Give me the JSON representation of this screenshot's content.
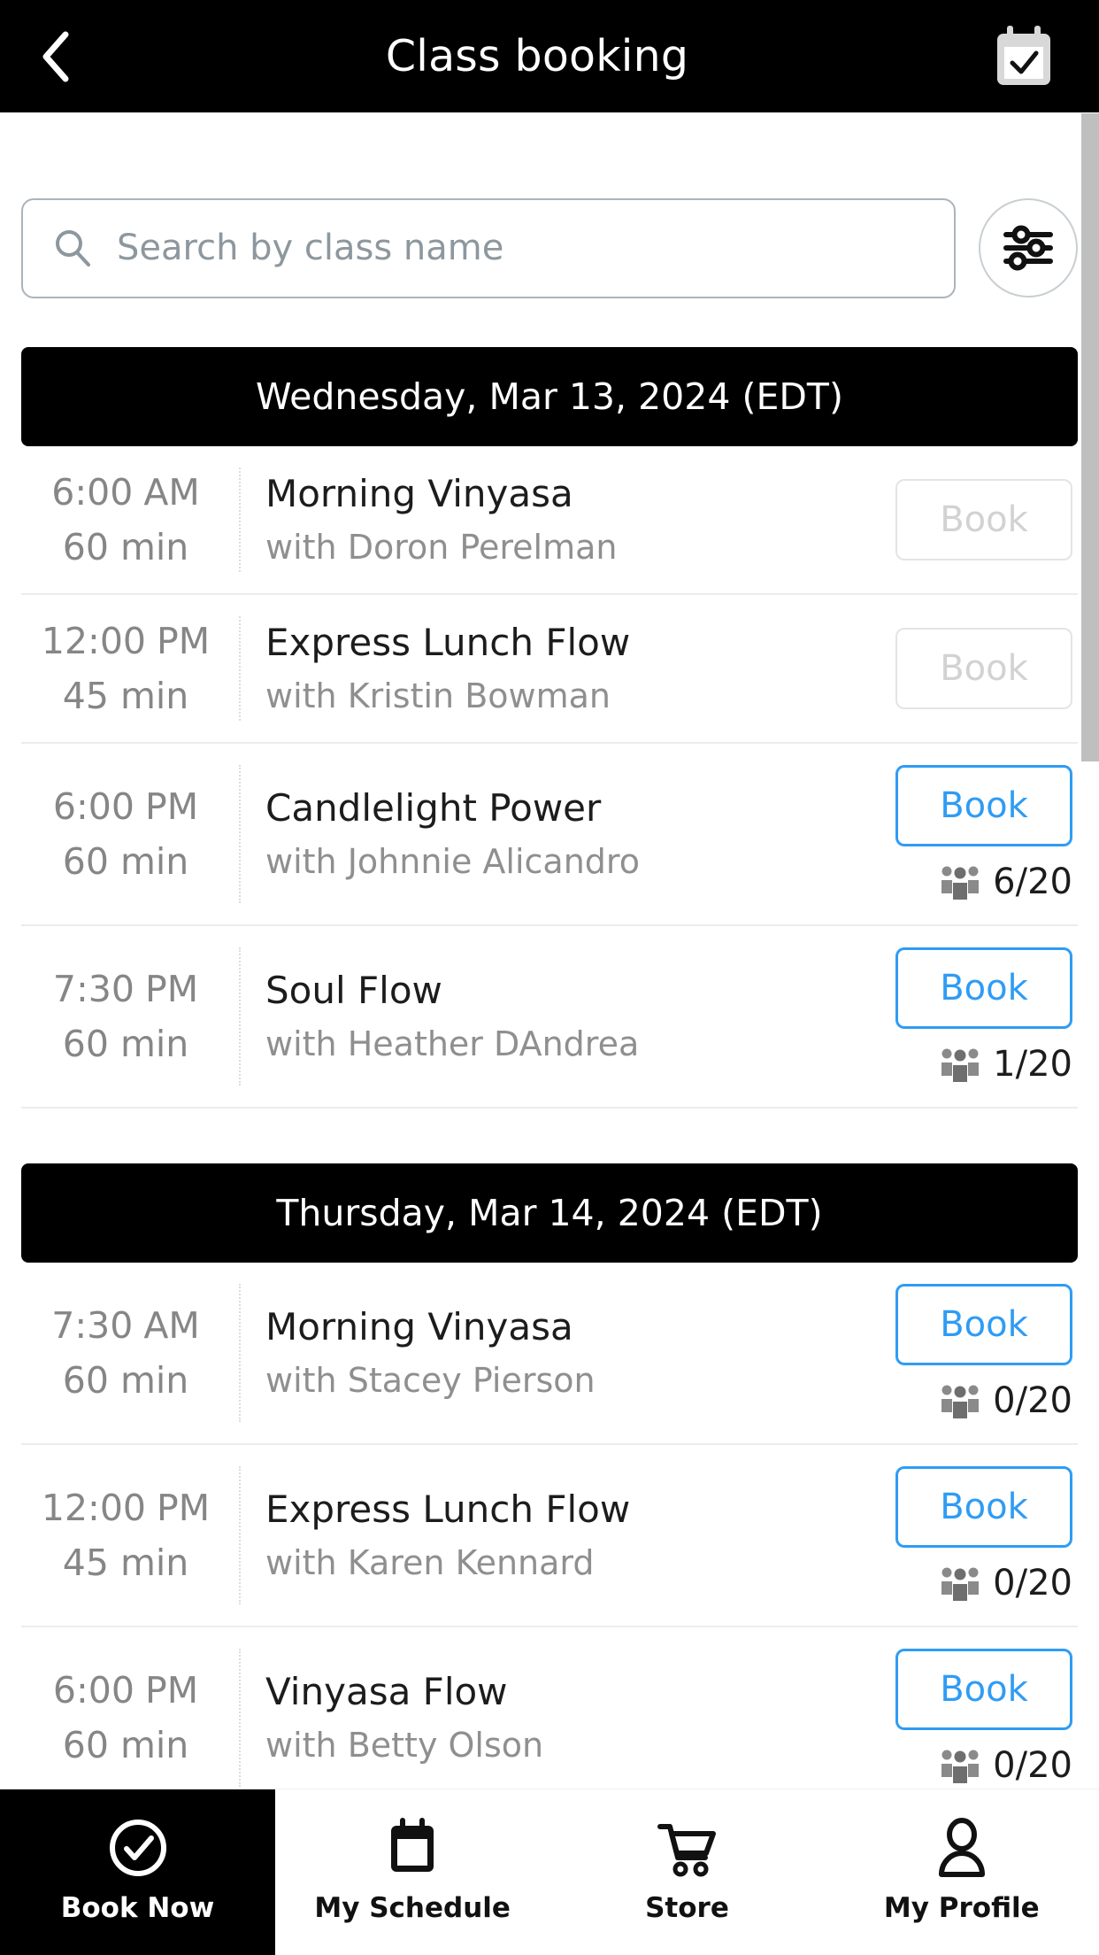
{
  "header": {
    "title": "Class booking",
    "back_icon": "chevron-left-icon",
    "calendar_icon": "calendar-check-icon"
  },
  "search": {
    "placeholder": "Search by class name",
    "value": "",
    "search_icon": "search-icon",
    "filter_icon": "sliders-filter-icon"
  },
  "days": [
    {
      "date_label": "Wednesday, Mar 13, 2024 (EDT)",
      "classes": [
        {
          "time": "6:00",
          "ampm": "AM",
          "duration": "60 min",
          "name": "Morning Vinyasa",
          "instructor": "with Doron Perelman",
          "book_label": "Book",
          "enabled": false,
          "capacity": ""
        },
        {
          "time": "12:00",
          "ampm": "PM",
          "duration": "45 min",
          "name": "Express Lunch Flow",
          "instructor": "with Kristin Bowman",
          "book_label": "Book",
          "enabled": false,
          "capacity": ""
        },
        {
          "time": "6:00",
          "ampm": "PM",
          "duration": "60 min",
          "name": "Candlelight Power",
          "instructor": "with Johnnie Alicandro",
          "book_label": "Book",
          "enabled": true,
          "capacity": "6/20"
        },
        {
          "time": "7:30",
          "ampm": "PM",
          "duration": "60 min",
          "name": "Soul Flow",
          "instructor": "with Heather DAndrea",
          "book_label": "Book",
          "enabled": true,
          "capacity": "1/20"
        }
      ]
    },
    {
      "date_label": "Thursday, Mar 14, 2024 (EDT)",
      "classes": [
        {
          "time": "7:30",
          "ampm": "AM",
          "duration": "60 min",
          "name": "Morning Vinyasa",
          "instructor": "with Stacey Pierson",
          "book_label": "Book",
          "enabled": true,
          "capacity": "0/20"
        },
        {
          "time": "12:00",
          "ampm": "PM",
          "duration": "45 min",
          "name": "Express Lunch Flow",
          "instructor": "with Karen Kennard",
          "book_label": "Book",
          "enabled": true,
          "capacity": "0/20"
        },
        {
          "time": "6:00",
          "ampm": "PM",
          "duration": "60 min",
          "name": "Vinyasa Flow",
          "instructor": "with Betty Olson",
          "book_label": "Book",
          "enabled": true,
          "capacity": "0/20"
        }
      ]
    }
  ],
  "bottom_nav": [
    {
      "label": "Book Now",
      "icon": "check-circle-icon",
      "active": true
    },
    {
      "label": "My Schedule",
      "icon": "calendar-icon",
      "active": false
    },
    {
      "label": "Store",
      "icon": "shopping-cart-icon",
      "active": false
    },
    {
      "label": "My Profile",
      "icon": "person-icon",
      "active": false
    }
  ],
  "colors": {
    "accent_blue": "#2f9cf4",
    "header_bg": "#000000",
    "disabled_gray": "#d2d2d2",
    "muted_text": "#868686"
  }
}
